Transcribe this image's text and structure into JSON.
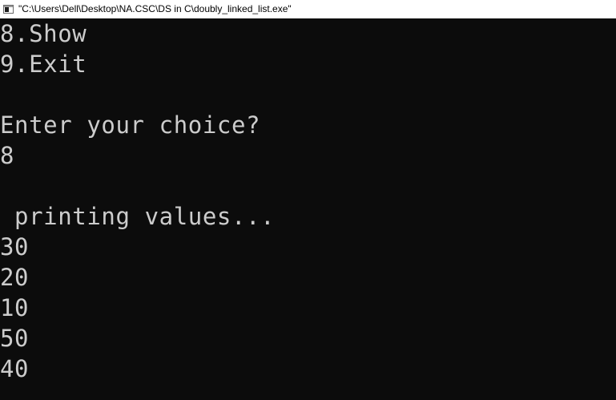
{
  "window": {
    "title": "\"C:\\Users\\Dell\\Desktop\\NA.CSC\\DS in C\\doubly_linked_list.exe\"",
    "icon": "console-app-icon"
  },
  "console": {
    "lines": [
      "8.Show",
      "9.Exit",
      "",
      "Enter your choice?",
      "8",
      "",
      " printing values...",
      "30",
      "20",
      "10",
      "50",
      "40"
    ]
  },
  "colors": {
    "background": "#0c0c0c",
    "text": "#cccccc",
    "titlebar": "#ffffff"
  }
}
